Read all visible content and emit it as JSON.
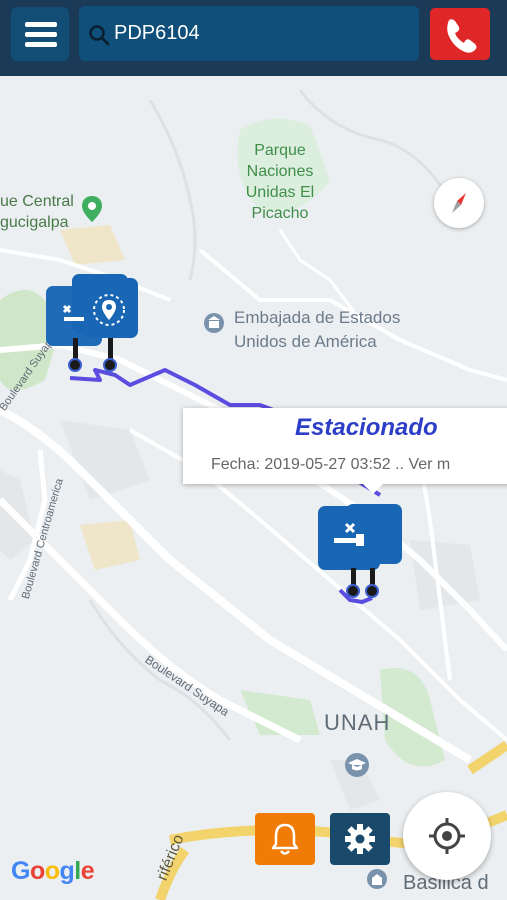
{
  "header": {
    "search_value": "PDP6104"
  },
  "map": {
    "labels": {
      "parque": [
        "Parque",
        "Naciones",
        "Unidas El",
        "Picacho"
      ],
      "central": [
        "ue Central",
        "gucigalpa"
      ],
      "embajada": [
        "Embajada de Estados",
        "Unidos de América"
      ],
      "blvd_centroamerica": "Boulevard Centroamerica",
      "blvd_suyapa": "Boulevard Suyapa",
      "blvd_suyapa_left": "Boulevard Suyapa",
      "unah": "UNAH",
      "periferico": "riférico",
      "basilica": "Basilica d"
    },
    "popup": {
      "title": "Estacionado",
      "date": "Fecha: 2019-05-27 03:52 .. Ver m"
    },
    "attribution": "Google"
  },
  "colors": {
    "header_bg": "#1b3a57",
    "search_bg": "#0f4f7a",
    "call_red": "#e02727",
    "bell_orange": "#f07b06",
    "marker_blue": "#1967b4",
    "route": "#5b4de0",
    "park_green": "#c8e6c9",
    "popup_title": "#2d3fc7"
  },
  "icons": [
    "menu-icon",
    "search-icon",
    "phone-icon",
    "compass-icon",
    "key-icon",
    "location-pin-icon",
    "bell-icon",
    "gear-icon",
    "locate-icon"
  ]
}
